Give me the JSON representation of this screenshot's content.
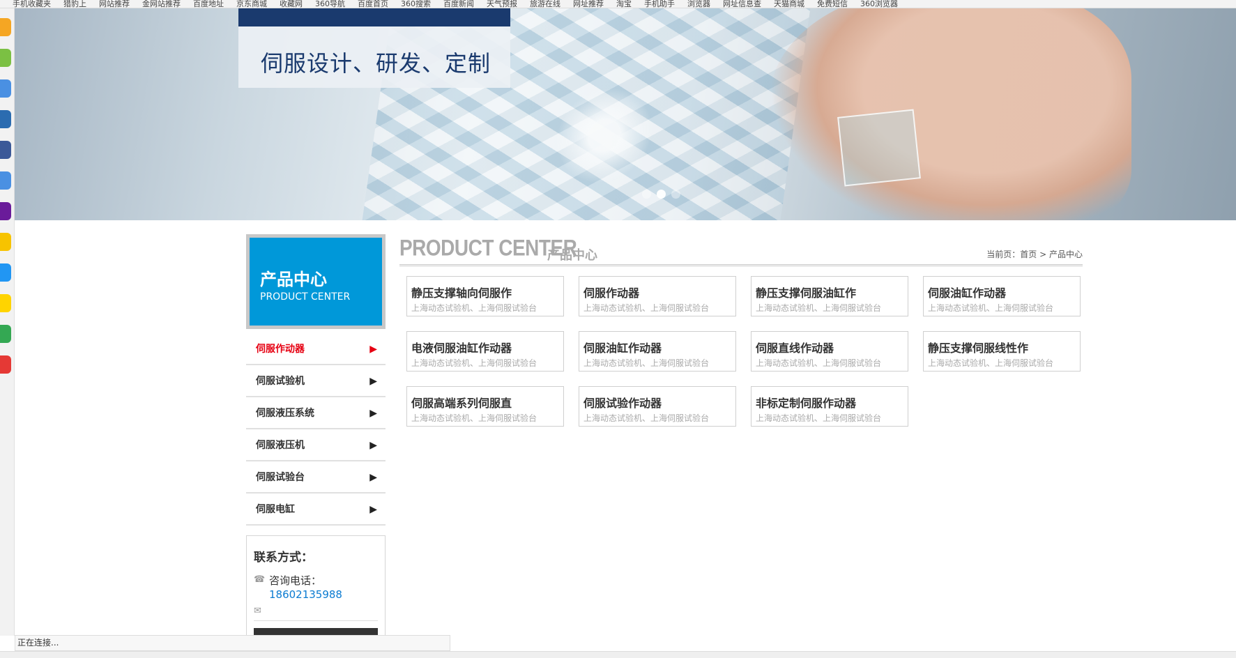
{
  "bookmarks": [
    "手机收藏夹",
    "猎豹上",
    "网站推荐",
    "金网站推荐",
    "百度地址",
    "京东商城",
    "收藏网",
    "360导航",
    "百度首页",
    "360搜索",
    "百度新闻",
    "天气预报",
    "旅游在线",
    "网址推荐",
    "淘宝",
    "手机助手",
    "浏览器",
    "网址信息查",
    "天猫商城",
    "免费短信",
    "360浏览器"
  ],
  "banner": {
    "tagline": "伺服设计、研发、定制",
    "slide_count": 3,
    "active_slide": 2
  },
  "sidebar": {
    "title_cn": "产品中心",
    "title_en": "PRODUCT CENTER",
    "items": [
      {
        "label": "伺服作动器",
        "arrow": "▶",
        "active": true
      },
      {
        "label": "伺服试验机",
        "arrow": "▶",
        "active": false
      },
      {
        "label": "伺服液压系统",
        "arrow": "▶",
        "active": false
      },
      {
        "label": "伺服液压机",
        "arrow": "▶",
        "active": false
      },
      {
        "label": "伺服试验台",
        "arrow": "▶",
        "active": false
      },
      {
        "label": "伺服电缸",
        "arrow": "▶",
        "active": false
      }
    ]
  },
  "contact": {
    "title": "联系方式：",
    "phone_label": "咨询电话：",
    "phone": "18602135988"
  },
  "content": {
    "title_en": "PRODUCT CENTER",
    "title_cn": "产品中心",
    "breadcrumb": {
      "prefix": "当前页：",
      "home": "首页",
      "sep": ">",
      "current": "产品中心"
    }
  },
  "products": [
    {
      "name": "静压支撑轴向伺服作",
      "desc": "上海动态试验机、上海伺服试验台"
    },
    {
      "name": "伺服作动器",
      "desc": "上海动态试验机、上海伺服试验台"
    },
    {
      "name": "静压支撑伺服油缸作",
      "desc": "上海动态试验机、上海伺服试验台"
    },
    {
      "name": "伺服油缸作动器",
      "desc": "上海动态试验机、上海伺服试验台"
    },
    {
      "name": "电液伺服油缸作动器",
      "desc": "上海动态试验机、上海伺服试验台"
    },
    {
      "name": "伺服油缸作动器",
      "desc": "上海动态试验机、上海伺服试验台"
    },
    {
      "name": "伺服直线作动器",
      "desc": "上海动态试验机、上海伺服试验台"
    },
    {
      "name": "静压支撑伺服线性作",
      "desc": "上海动态试验机、上海伺服试验台"
    },
    {
      "name": "伺服高端系列伺服直",
      "desc": "上海动态试验机、上海伺服试验台"
    },
    {
      "name": "伺服试验作动器",
      "desc": "上海动态试验机、上海伺服试验台"
    },
    {
      "name": "非标定制伺服作动器",
      "desc": "上海动态试验机、上海伺服试验台"
    }
  ],
  "status_text": "正在连接...",
  "colors": {
    "accent_blue": "#0098d9",
    "active_red": "#e60012",
    "phone_blue": "#0b7bd1",
    "banner_navy": "#1a3a6e"
  }
}
